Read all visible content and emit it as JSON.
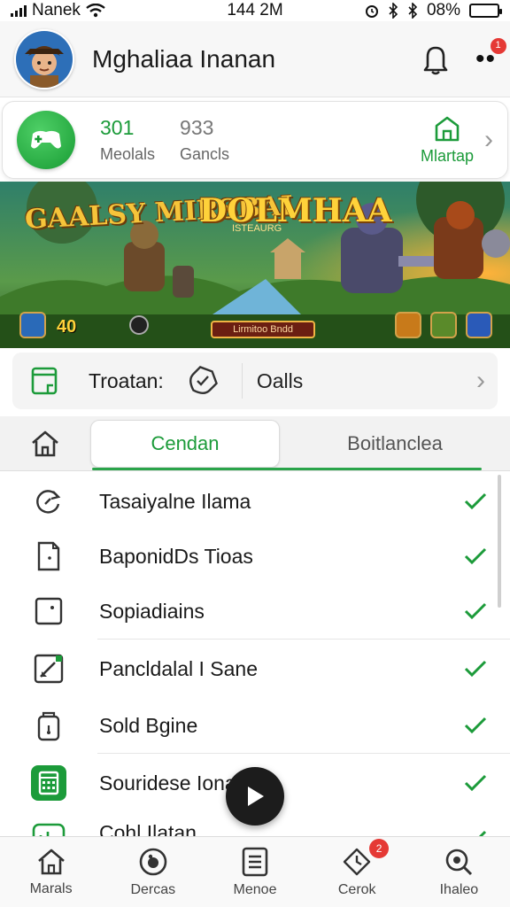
{
  "status_bar": {
    "carrier": "Nanek",
    "time": "144 2M",
    "battery": "08%",
    "battery_level": 0.2
  },
  "header": {
    "username": "Mghaliaa  Inanan",
    "notification_badge": "1"
  },
  "stats": [
    {
      "value": "301",
      "label": "Meolals"
    },
    {
      "value": "933",
      "label": "Gancls"
    },
    {
      "value": "",
      "label": "Mlartap"
    }
  ],
  "banner": {
    "title_left": "GAALSY MIRSBAI",
    "title_main": "DOLMHAA",
    "subtitle": "ISTEAURG",
    "score": "40",
    "button": "Lirmitoo Bndd"
  },
  "info_bar": {
    "label": "Troatan:",
    "value": "Oalls"
  },
  "tabs": {
    "active": "Cendan",
    "inactive": "Boitlanclea"
  },
  "list": [
    {
      "label": "Tasaiyalne Ilama",
      "icon": "refresh-icon",
      "checked": true
    },
    {
      "label": "BaponidDs Tioas",
      "icon": "document-icon",
      "checked": true
    },
    {
      "label": "Sopiadiains",
      "icon": "dice-icon",
      "checked": true
    },
    {
      "label": "Pancldalal I Sane",
      "icon": "edit-icon",
      "checked": true
    },
    {
      "label": "Sold Bgine",
      "icon": "bag-icon",
      "checked": true
    },
    {
      "label": "Souridese Ionas",
      "icon": "calendar-icon",
      "checked": true
    },
    {
      "label": "Cohl Ilatan",
      "icon": "chart-icon",
      "checked": true
    }
  ],
  "bottom_nav": [
    {
      "label": "Marals",
      "icon": "home-icon"
    },
    {
      "label": "Dercas",
      "icon": "record-icon"
    },
    {
      "label": "Menoe",
      "icon": "list-icon"
    },
    {
      "label": "Cerok",
      "icon": "clock-icon",
      "badge": "2"
    },
    {
      "label": "Ihaleo",
      "icon": "search-icon"
    }
  ],
  "colors": {
    "accent": "#1c9b3a",
    "badge": "#e53935"
  }
}
